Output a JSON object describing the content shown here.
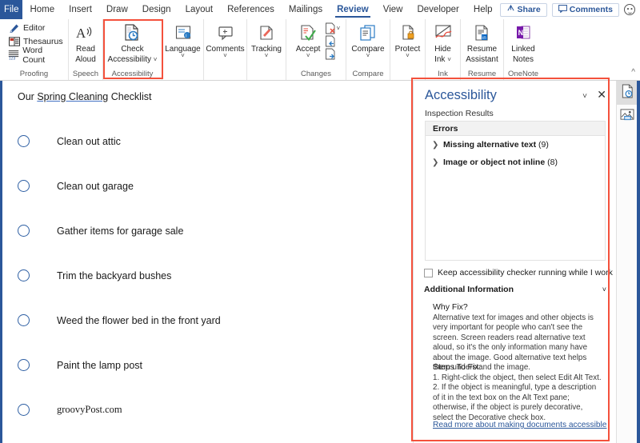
{
  "window": {
    "app": "Microsoft Word",
    "accent_color": "#2b579a",
    "highlight_color": "#f4513c"
  },
  "ribbon": {
    "file_tab": "File",
    "tabs": [
      {
        "label": "Home",
        "active": false
      },
      {
        "label": "Insert",
        "active": false
      },
      {
        "label": "Draw",
        "active": false
      },
      {
        "label": "Design",
        "active": false
      },
      {
        "label": "Layout",
        "active": false
      },
      {
        "label": "References",
        "active": false
      },
      {
        "label": "Mailings",
        "active": false
      },
      {
        "label": "Review",
        "active": true
      },
      {
        "label": "View",
        "active": false
      },
      {
        "label": "Developer",
        "active": false
      },
      {
        "label": "Help",
        "active": false
      }
    ],
    "share_label": "Share",
    "comments_label": "Comments",
    "groups": [
      {
        "name": "proofing",
        "label": "Proofing",
        "items": [
          {
            "label": "Editor",
            "icon": "pen-editor-icon"
          },
          {
            "label": "Thesaurus",
            "icon": "book-thesaurus-icon"
          },
          {
            "label": "Word Count",
            "icon": "word-count-icon"
          }
        ]
      },
      {
        "name": "speech",
        "label": "Speech",
        "items": [
          {
            "label_line1": "Read",
            "label_line2": "Aloud",
            "icon": "read-aloud-icon"
          }
        ]
      },
      {
        "name": "accessibility",
        "label": "Accessibility",
        "items": [
          {
            "label_line1": "Check",
            "label_line2": "Accessibility",
            "icon": "check-accessibility-icon",
            "has_dropdown": true
          }
        ]
      },
      {
        "name": "language",
        "label": "",
        "items": [
          {
            "label_line1": "Language",
            "label_line2": "",
            "icon": "language-icon",
            "has_dropdown": true
          }
        ]
      },
      {
        "name": "comments",
        "label": "",
        "items": [
          {
            "label_line1": "Comments",
            "label_line2": "",
            "icon": "comment-bubble-icon",
            "has_dropdown": true
          }
        ]
      },
      {
        "name": "tracking",
        "label": "",
        "items": [
          {
            "label_line1": "Tracking",
            "label_line2": "",
            "icon": "track-changes-icon",
            "has_dropdown": true
          }
        ]
      },
      {
        "name": "changes",
        "label": "Changes",
        "items": [
          {
            "label_line1": "Accept",
            "label_line2": "",
            "icon": "accept-change-icon",
            "has_dropdown": true
          },
          {
            "label_line1": "",
            "label_line2": "",
            "icon": "reject-change-icon",
            "has_dropdown": true
          },
          {
            "label_line1": "",
            "label_line2": "",
            "icon": "previous-change-icon"
          },
          {
            "label_line1": "",
            "label_line2": "",
            "icon": "next-change-icon"
          }
        ]
      },
      {
        "name": "compare",
        "label": "Compare",
        "items": [
          {
            "label_line1": "Compare",
            "label_line2": "",
            "icon": "compare-documents-icon",
            "has_dropdown": true
          }
        ]
      },
      {
        "name": "protect",
        "label": "",
        "items": [
          {
            "label_line1": "Protect",
            "label_line2": "",
            "icon": "protect-lock-icon",
            "has_dropdown": true
          }
        ]
      },
      {
        "name": "ink",
        "label": "Ink",
        "items": [
          {
            "label_line1": "Hide",
            "label_line2": "Ink",
            "icon": "hide-ink-icon",
            "has_dropdown": true
          }
        ]
      },
      {
        "name": "resume",
        "label": "Resume",
        "items": [
          {
            "label_line1": "Resume",
            "label_line2": "Assistant",
            "icon": "resume-assistant-icon"
          }
        ]
      },
      {
        "name": "onenote",
        "label": "OneNote",
        "items": [
          {
            "label_line1": "Linked",
            "label_line2": "Notes",
            "icon": "linked-notes-icon"
          }
        ]
      }
    ],
    "collapse_ribbon": "^"
  },
  "document": {
    "title_pre": "Our ",
    "title_underlined": "Spring Cleaning",
    "title_post": " Checklist",
    "checklist": [
      {
        "text": "Clean out attic",
        "checked": false
      },
      {
        "text": "Clean out garage",
        "checked": false
      },
      {
        "text": "Gather items for garage sale",
        "checked": false
      },
      {
        "text": "Trim the backyard bushes",
        "checked": false
      },
      {
        "text": "Weed the flower bed in the front yard",
        "checked": false
      },
      {
        "text": "Paint the lamp post",
        "checked": false
      }
    ],
    "watermark": "groovyPost.com"
  },
  "pane": {
    "title": "Accessibility",
    "subtitle": "Inspection Results",
    "errors_header": "Errors",
    "errors": [
      {
        "label": "Missing alternative text",
        "count": "(9)"
      },
      {
        "label": "Image or object not inline",
        "count": "(8)"
      }
    ],
    "keep_running_label": "Keep accessibility checker running while I work",
    "keep_running_checked": false,
    "additional_information": "Additional Information",
    "why_fix_heading": "Why Fix?",
    "why_fix_body": "Alternative text for images and other objects is very important for people who can't see the screen. Screen readers read alternative text aloud, so it's the only information many have about the image. Good alternative text helps them understand the image.",
    "steps_heading": "Steps To Fix:",
    "steps_body": "1. Right-click the object, then select Edit Alt Text. 2. If the object is meaningful, type a description of it in the text box on the Alt Text pane; otherwise, if the object is purely decorative, select the Decorative check box.",
    "link": "Read more about making documents accessible"
  },
  "right_strip": {
    "buttons": [
      {
        "icon": "accessibility-checker-icon",
        "selected": true
      },
      {
        "icon": "alt-text-image-icon",
        "selected": false
      }
    ]
  }
}
